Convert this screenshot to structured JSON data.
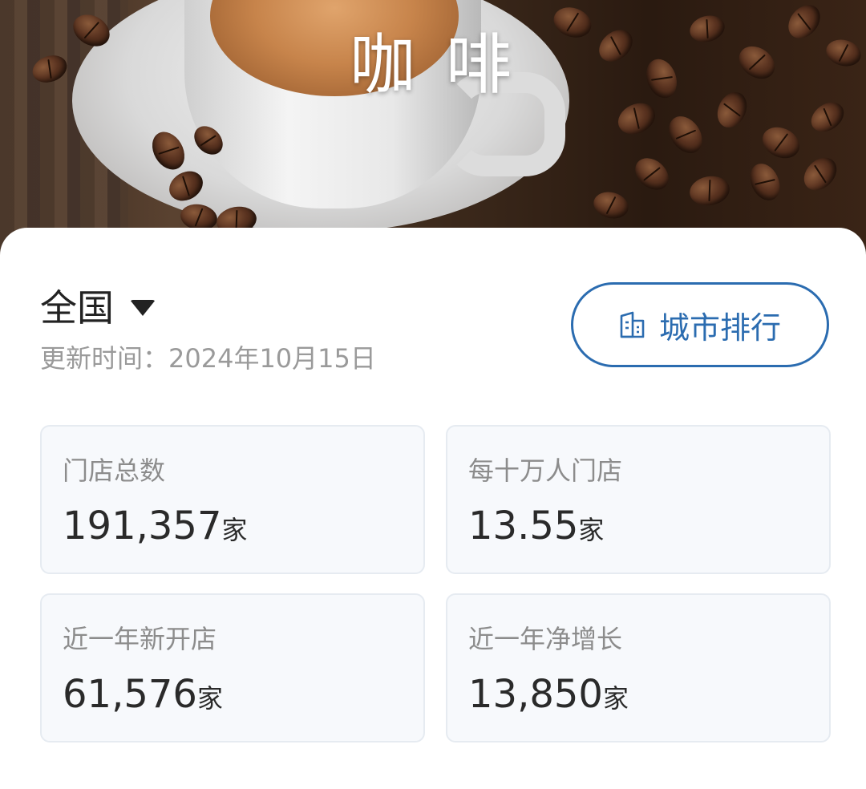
{
  "hero": {
    "title": "咖 啡"
  },
  "region_selector": {
    "label": "全国"
  },
  "update_info": {
    "text": "更新时间：2024年10月15日"
  },
  "city_rank_button": {
    "label": "城市排行",
    "icon": "building-icon"
  },
  "stats": [
    {
      "label": "门店总数",
      "value": "191,357",
      "unit": "家"
    },
    {
      "label": "每十万人门店",
      "value": "13.55",
      "unit": "家"
    },
    {
      "label": "近一年新开店",
      "value": "61,576",
      "unit": "家"
    },
    {
      "label": "近一年净增长",
      "value": "13,850",
      "unit": "家"
    }
  ],
  "colors": {
    "accent": "#2b6cb0",
    "card_bg": "#f7f9fc",
    "muted_text": "#9a9a9a"
  }
}
